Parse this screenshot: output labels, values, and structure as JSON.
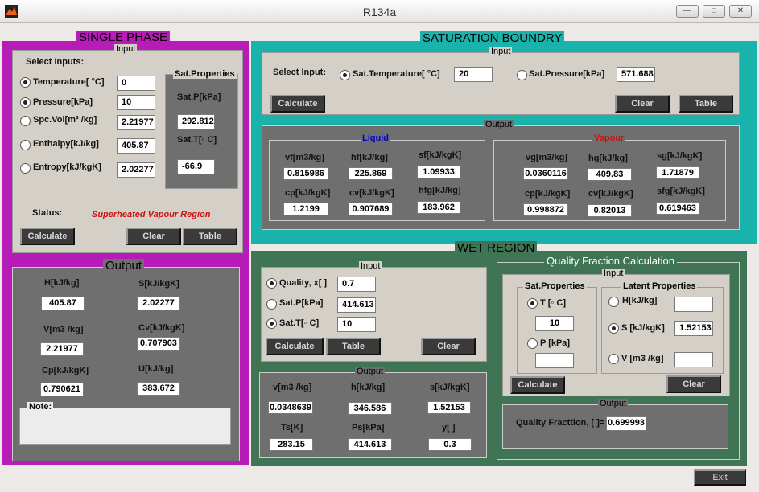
{
  "window": {
    "title": "R134a"
  },
  "single_phase": {
    "header": "SINGLE PHASE",
    "input_title": "Input",
    "select_inputs": "Select Inputs:",
    "rows": [
      {
        "label": "Temperature[ °C]",
        "value": "0",
        "selected": true
      },
      {
        "label": "Pressure[kPa]",
        "value": "10",
        "selected": true
      },
      {
        "label": "Spc.Vol[m³ /kg]",
        "value": "2.21977",
        "selected": false
      },
      {
        "label": "Enthalpy[kJ/kg]",
        "value": "405.87",
        "selected": false
      },
      {
        "label": "Entropy[kJ/kgK]",
        "value": "2.02277",
        "selected": false
      }
    ],
    "sat_props_title": "Sat.Properties",
    "satp_label": "Sat.P[kPa]",
    "satp_value": "292.812",
    "satt_label": "Sat.T[◦ C]",
    "satt_value": "-66.9",
    "status_label": "Status:",
    "status_value": "Superheated Vapour Region",
    "calculate": "Calculate",
    "clear": "Clear",
    "table": "Table",
    "output": {
      "title": "Output",
      "h_label": "H[kJ/kg]",
      "h_value": "405.87",
      "s_label": "S[kJ/kgK]",
      "s_value": "2.02277",
      "v_label": "V[m3  /kg]",
      "v_value": "2.21977",
      "cv_label": "Cv[kJ/kgK]",
      "cv_value": "0.707903",
      "cp_label": "Cp[kJ/kgK]",
      "cp_value": "0.790621",
      "u_label": "U[kJ/kg]",
      "u_value": "383.672",
      "note_label": "Note:"
    }
  },
  "saturation": {
    "header": "SATURATION BOUNDRY",
    "input_title": "Input",
    "select_input": "Select Input:",
    "temp_label": "Sat.Temperature[ °C]",
    "temp_value": "20",
    "press_label": "Sat.Pressure[kPa]",
    "press_value": "571.688",
    "calculate": "Calculate",
    "clear": "Clear",
    "table": "Table",
    "output_title": "Output",
    "liquid_title": "Liquid",
    "vapour_title": "Vapour",
    "liquid": {
      "vf_label": "vf[m3/kg]",
      "vf": "0.815986",
      "hf_label": "hf[kJ/kg]",
      "hf": "225.869",
      "sf_label": "sf[kJ/kgK]",
      "sf": "1.09933",
      "cp_label": "cp[kJ/kgK]",
      "cp": "1.2199",
      "cv_label": "cv[kJ/kgK]",
      "cv": "0.907689",
      "hfg_label": "hfg[kJ/kg]",
      "hfg": "183.962"
    },
    "vapour": {
      "vg_label": "vg[m3/kg]",
      "vg": "0.0360116",
      "hg_label": "hg[kJ/kg]",
      "hg": "409.83",
      "sg_label": "sg[kJ/kgK]",
      "sg": "1.71879",
      "cp_label": "cp[kJ/kgK]",
      "cp": "0.998872",
      "cv_label": "cv[kJ/kgK]",
      "cv": "0.82013",
      "sfg_label": "sfg[kJ/kgK]",
      "sfg": "0.619463"
    }
  },
  "wet": {
    "header": "WET REGION",
    "input_title": "Input",
    "quality_label": "Quality, x[  ]",
    "quality_value": "0.7",
    "satp_label": "Sat.P[kPa]",
    "satp_value": "414.613",
    "satt_label": "Sat.T[◦ C]",
    "satt_value": "10",
    "calculate": "Calculate",
    "table": "Table",
    "clear": "Clear",
    "output_title": "Output",
    "v_label": "v[m3 /kg]",
    "v_value": "0.0348639",
    "h_label": "h[kJ/kg]",
    "h_value": "346.586",
    "s_label": "s[kJ/kgK]",
    "s_value": "1.52153",
    "ts_label": "Ts[K]",
    "ts_value": "283.15",
    "ps_label": "Ps[kPa]",
    "ps_value": "414.613",
    "y_label": "y[  ]",
    "y_value": "0.3"
  },
  "quality": {
    "title": "Quality Fraction Calculation",
    "input_title": "Input",
    "sat_props_title": "Sat.Properties",
    "latent_title": "Latent Properties",
    "t_label": "T [◦ C]",
    "t_value": "10",
    "p_label": "P [kPa]",
    "p_value": "",
    "h_label": "H[kJ/kg]",
    "h_value": "",
    "s_label": "S [kJ/kgK]",
    "s_value": "1.52153",
    "v_label": "V [m3 /kg]",
    "v_value": "",
    "calculate": "Calculate",
    "clear": "Clear",
    "output_title": "Output",
    "fraction_label": "Quality Fracttion, [ ]=",
    "fraction_value": "0.699993"
  },
  "exit": "Exit",
  "colors": {
    "magenta": "#b81cb8",
    "teal": "#19b3ab",
    "green": "#3f7455",
    "panel_gray": "#6f6f6f",
    "light_gray": "#d4d0c8"
  }
}
